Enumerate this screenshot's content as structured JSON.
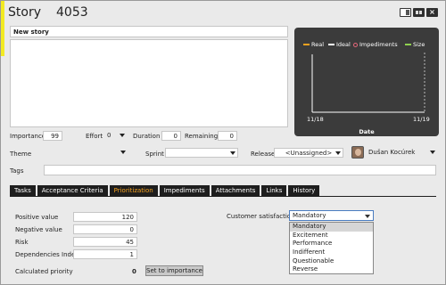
{
  "window": {
    "item_type": "Story",
    "item_number": "4053",
    "accent_color": "#f2ea22",
    "controls": [
      "restore-icon",
      "switch-view-icon",
      "close-icon"
    ]
  },
  "story": {
    "name_value": "New story",
    "description_value": ""
  },
  "chart": {
    "bg_color": "#3b3b3b",
    "legend": [
      {
        "label": "Real",
        "color": "#f6a21f"
      },
      {
        "label": "Ideal",
        "color": "#ffffff"
      },
      {
        "label": "Impediments",
        "color": "#e6677a"
      },
      {
        "label": "Size",
        "color": "#8fd14f"
      }
    ]
  },
  "chart_data": {
    "type": "line",
    "title": "",
    "xlabel": "Date",
    "ylabel": "",
    "x_ticks": [
      "11/18",
      "11/19"
    ],
    "series": [
      {
        "name": "Real",
        "values": []
      },
      {
        "name": "Ideal",
        "values": []
      },
      {
        "name": "Impediments",
        "values": []
      },
      {
        "name": "Size",
        "values": []
      }
    ],
    "grid": true,
    "legend_position": "top"
  },
  "metrics": {
    "importance_label": "Importance",
    "importance_value": "99",
    "effort_label": "Effort",
    "effort_value": "0",
    "duration_label": "Duration",
    "duration_value": "0",
    "remaining_label": "Remaining",
    "remaining_value": "0"
  },
  "planning": {
    "theme_label": "Theme",
    "theme_value": "",
    "sprint_label": "Sprint",
    "sprint_value": "",
    "release_label": "Release",
    "release_value": "<Unassigned>",
    "owner_name": "Dušan Kocúrek"
  },
  "tags": {
    "label": "Tags",
    "value": ""
  },
  "tabs": [
    {
      "label": "Tasks",
      "active": false
    },
    {
      "label": "Acceptance Criteria",
      "active": false
    },
    {
      "label": "Prioritization",
      "active": true
    },
    {
      "label": "Impediments",
      "active": false
    },
    {
      "label": "Attachments",
      "active": false
    },
    {
      "label": "Links",
      "active": false
    },
    {
      "label": "History",
      "active": false
    }
  ],
  "prioritization": {
    "positive_label": "Positive value",
    "positive_value": "120",
    "negative_label": "Negative value",
    "negative_value": "0",
    "risk_label": "Risk",
    "risk_value": "45",
    "dependencies_label": "Dependencies Index",
    "dependencies_value": "1",
    "calculated_label": "Calculated priority",
    "calculated_value": "0",
    "set_button_label": "Set to importance",
    "customer_satisfaction_label": "Customer satisfaction",
    "customer_satisfaction_value": "Mandatory",
    "customer_satisfaction_options": [
      "Mandatory",
      "Excitement",
      "Performance",
      "Indifferent",
      "Questionable",
      "Reverse"
    ]
  }
}
